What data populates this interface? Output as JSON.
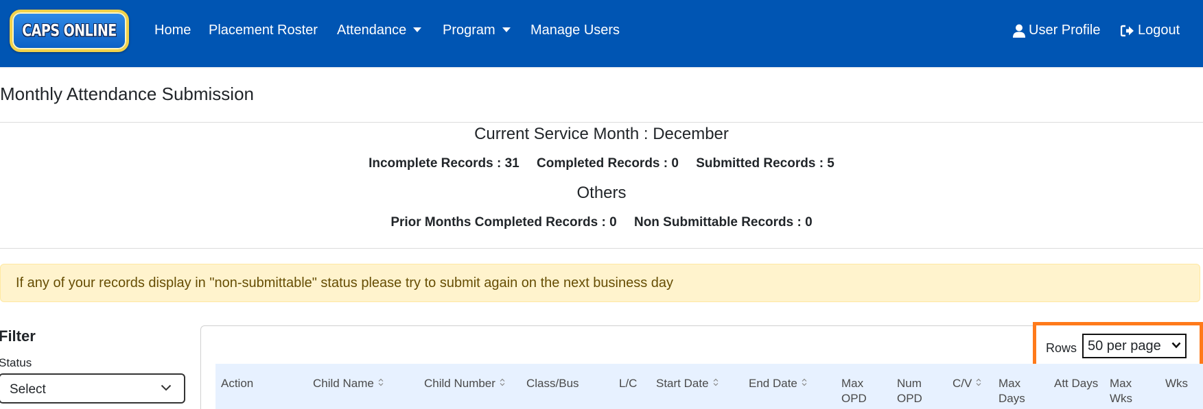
{
  "navbar": {
    "logo_text": "CAPS ONLINE",
    "items": [
      {
        "label": "Home",
        "icon": null
      },
      {
        "label": "Placement Roster",
        "icon": null
      },
      {
        "label": "Attendance",
        "icon": "caret-down-icon"
      },
      {
        "label": "Program",
        "icon": "caret-down-icon"
      },
      {
        "label": "Manage Users",
        "icon": null
      }
    ],
    "right": [
      {
        "label": "User Profile",
        "icon": "user-icon"
      },
      {
        "label": "Logout",
        "icon": "logout-icon"
      }
    ],
    "bg_color": "#0055b3"
  },
  "page": {
    "title": "Monthly Attendance Submission"
  },
  "summary": {
    "current_service_month": "Current Service Month : December",
    "incomplete": "Incomplete Records : 31",
    "completed": "Completed Records : 0",
    "submitted": "Submitted Records : 5",
    "others_title": "Others",
    "prior_months_completed": "Prior Months Completed Records : 0",
    "non_submittable": "Non Submittable Records : 0"
  },
  "alert": {
    "text": "If any of your records display in \"non-submittable\" status please try to submit again on the next business day",
    "bg_color": "#fff3cd"
  },
  "filter": {
    "title": "Filter",
    "status_label": "Status",
    "status_value": "Select"
  },
  "table": {
    "rows_label": "Rows",
    "rows_per_page": "50 per page",
    "highlight_color": "#ff7a1a",
    "columns": [
      {
        "label": "Action",
        "sortable": false
      },
      {
        "label": "Child Name",
        "sortable": true
      },
      {
        "label": "Child Number",
        "sortable": true
      },
      {
        "label": "Class/Bus",
        "sortable": false
      },
      {
        "label": "L/C",
        "sortable": false
      },
      {
        "label": "Start Date",
        "sortable": true
      },
      {
        "label": "End Date",
        "sortable": true
      },
      {
        "label": "Max",
        "label2": "OPD",
        "sortable": false
      },
      {
        "label": "Num",
        "label2": "OPD",
        "sortable": false
      },
      {
        "label": "C/V",
        "sortable": true
      },
      {
        "label": "Max",
        "label2": "Days",
        "sortable": false
      },
      {
        "label": "Att Days",
        "sortable": false
      },
      {
        "label": "Max",
        "label2": "Wks",
        "sortable": false
      },
      {
        "label": "Wks",
        "sortable": false
      }
    ]
  }
}
